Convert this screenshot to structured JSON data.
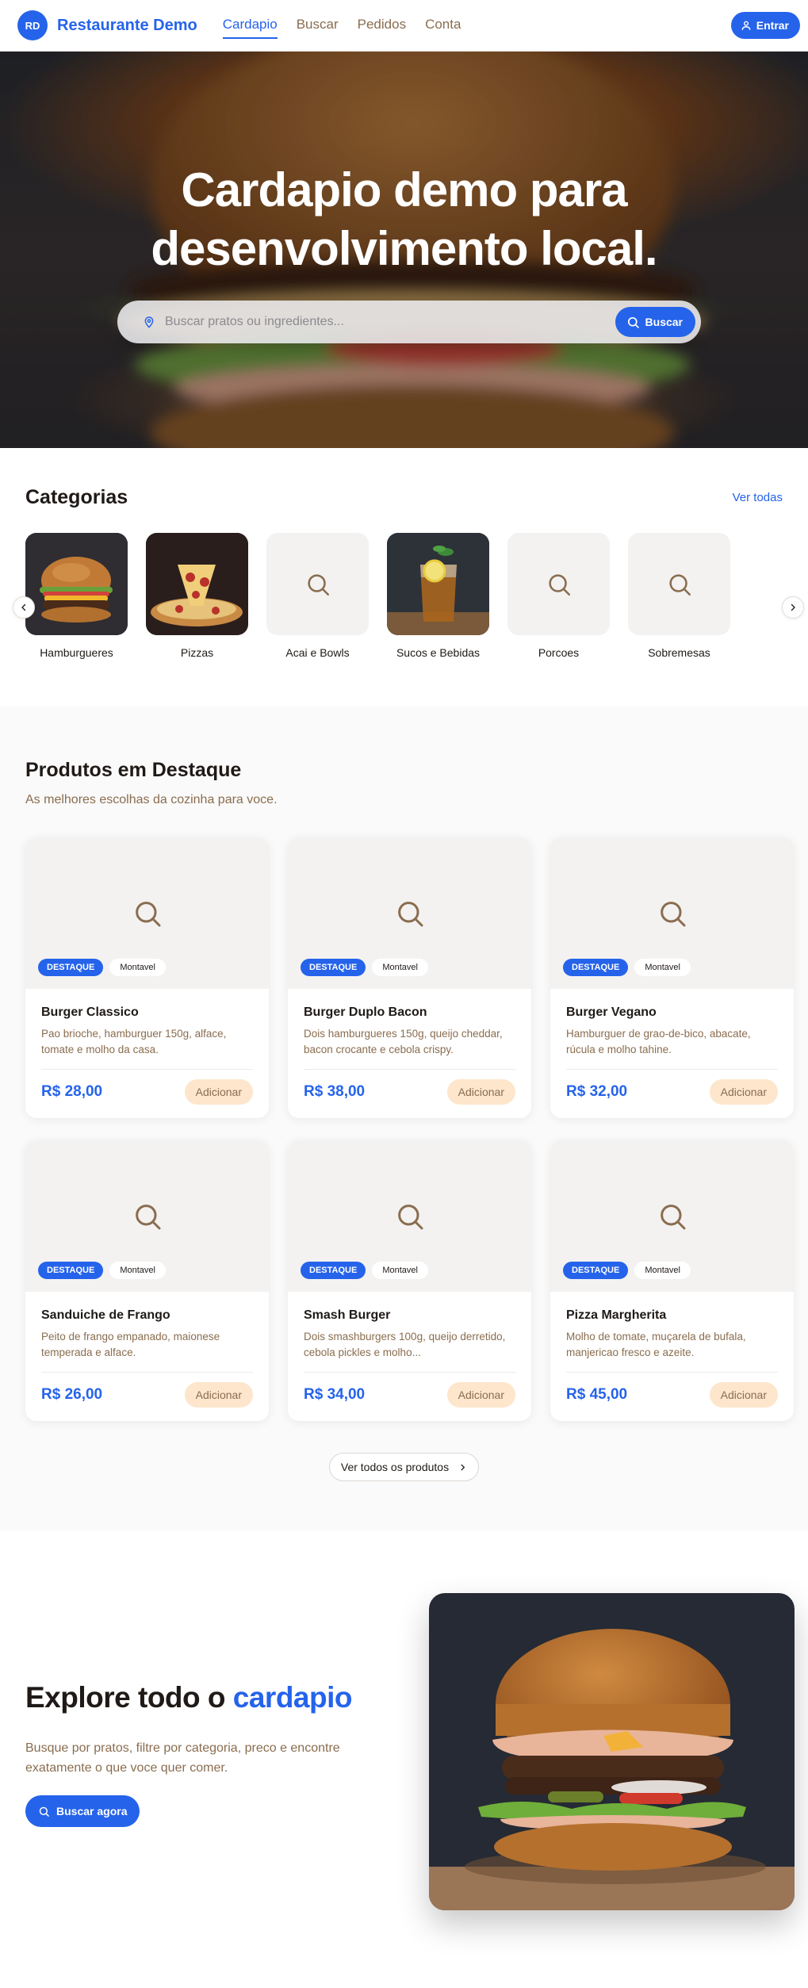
{
  "header": {
    "logo_initials": "RD",
    "brand": "Restaurante Demo",
    "nav": [
      {
        "label": "Cardapio",
        "active": true
      },
      {
        "label": "Buscar",
        "active": false
      },
      {
        "label": "Pedidos",
        "active": false
      },
      {
        "label": "Conta",
        "active": false
      }
    ],
    "login_label": "Entrar"
  },
  "hero": {
    "title_line1": "Cardapio demo para",
    "title_line2": "desenvolvimento local.",
    "search_placeholder": "Buscar pratos ou ingredientes...",
    "search_button": "Buscar"
  },
  "categories": {
    "title": "Categorias",
    "see_all": "Ver todas",
    "items": [
      {
        "label": "Hamburgueres",
        "image": "burger"
      },
      {
        "label": "Pizzas",
        "image": "pizza"
      },
      {
        "label": "Acai e Bowls",
        "image": "placeholder-search-icon"
      },
      {
        "label": "Sucos e Bebidas",
        "image": "drink"
      },
      {
        "label": "Porcoes",
        "image": "placeholder-search-icon"
      },
      {
        "label": "Sobremesas",
        "image": "placeholder-search-icon"
      }
    ]
  },
  "featured": {
    "title": "Produtos em Destaque",
    "subtitle": "As melhores escolhas da cozinha para voce.",
    "badge_featured": "DESTAQUE",
    "badge_available": "Montavel",
    "add_label": "Adicionar",
    "products": [
      {
        "name": "Burger Classico",
        "description": "Pao brioche, hamburguer 150g, alface, tomate e molho da casa.",
        "price": "R$ 28,00"
      },
      {
        "name": "Burger Duplo Bacon",
        "description": "Dois hamburgueres 150g, queijo cheddar, bacon crocante e cebola crispy.",
        "price": "R$ 38,00"
      },
      {
        "name": "Burger Vegano",
        "description": "Hamburguer de grao-de-bico, abacate, rúcula e molho tahine.",
        "price": "R$ 32,00"
      },
      {
        "name": "Sanduiche de Frango",
        "description": "Peito de frango empanado, maionese temperada e alface.",
        "price": "R$ 26,00"
      },
      {
        "name": "Smash Burger",
        "description": "Dois smashburgers 100g, queijo derretido, cebola pickles e molho...",
        "price": "R$ 34,00"
      },
      {
        "name": "Pizza Margherita",
        "description": "Molho de tomate, muçarela de bufala, manjericao fresco e azeite.",
        "price": "R$ 45,00"
      }
    ],
    "see_all_products": "Ver todos os produtos"
  },
  "explore": {
    "title_prefix": "Explore todo o ",
    "title_highlight": "cardapio",
    "text": "Busque por pratos, filtre por categoria, preco e encontre exatamente o que voce quer comer.",
    "button": "Buscar agora"
  },
  "colors": {
    "accent": "#2563eb",
    "muted_text": "#8a6d4f",
    "add_button_bg": "#fde6cc"
  }
}
